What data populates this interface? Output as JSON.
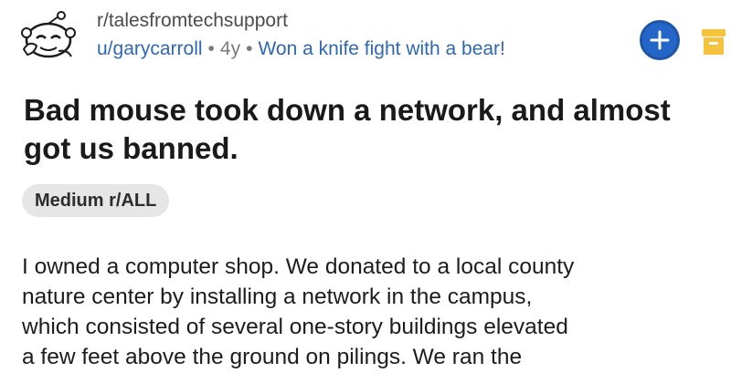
{
  "post": {
    "subreddit": "r/talesfromtechsupport",
    "author": "u/garycarroll",
    "age": "4y",
    "author_flair": "Won a knife fight with a bear!",
    "title": "Bad mouse took down a network, and almost got us banned.",
    "tag": "Medium r/ALL",
    "body_lines": [
      "I owned a computer shop. We donated to a local county",
      "nature center by installing a network in the campus,",
      "which consisted of several one-story buildings elevated",
      "a few feet above the ground on pilings. We ran the"
    ]
  },
  "icons": {
    "avatar": "reddit-snoo-avatar",
    "join": "plus-icon",
    "award": "archive-box-icon"
  },
  "colors": {
    "link_blue": "#2f67b2",
    "join_button": "#2366c8",
    "award_yellow": "#f6c33e",
    "tag_bg": "#e6e6e6"
  }
}
